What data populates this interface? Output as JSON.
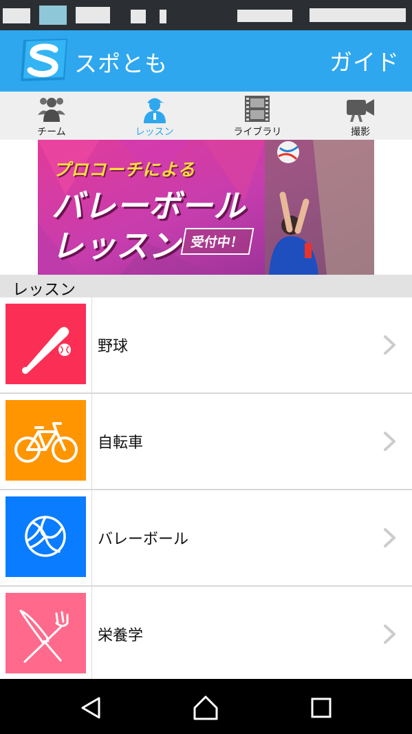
{
  "header": {
    "title": "スポとも",
    "guide_label": "ガイド",
    "logo_letter": "S",
    "color": "#2ea7ef"
  },
  "tabs": [
    {
      "label": "チーム",
      "icon": "team-icon",
      "active": false
    },
    {
      "label": "レッスン",
      "icon": "coach-icon",
      "active": true
    },
    {
      "label": "ライブラリ",
      "icon": "film-icon",
      "active": false
    },
    {
      "label": "撮影",
      "icon": "video-camera-icon",
      "active": false
    }
  ],
  "banner": {
    "line1": "プロコーチによる",
    "line2": "バレーボール",
    "line3": "レッスン",
    "badge": "受付中！"
  },
  "section": {
    "title": "レッスン"
  },
  "lessons": [
    {
      "label": "野球",
      "icon": "baseball-bat-icon",
      "color": "#fb2f55"
    },
    {
      "label": "自転車",
      "icon": "bicycle-icon",
      "color": "#ff9500"
    },
    {
      "label": "バレーボール",
      "icon": "volleyball-icon",
      "color": "#0a7cff"
    },
    {
      "label": "栄養学",
      "icon": "fork-knife-icon",
      "color": "#ff6a8c"
    }
  ],
  "nav": [
    "back-icon",
    "home-icon",
    "recents-icon"
  ]
}
